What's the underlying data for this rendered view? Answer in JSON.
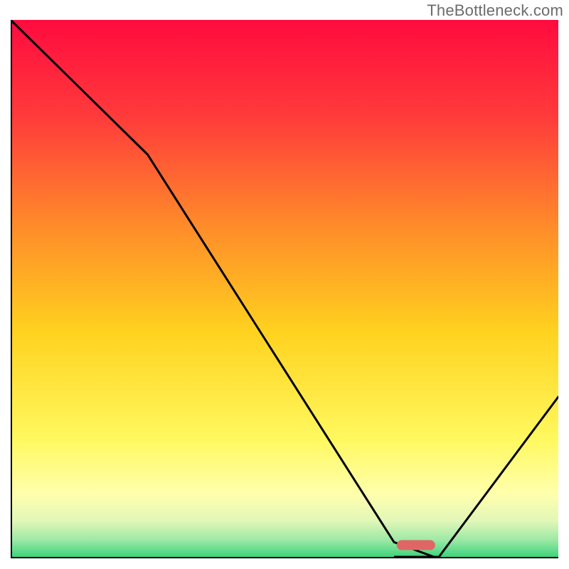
{
  "watermark": "TheBottleneck.com",
  "chart_data": {
    "type": "line",
    "title": "",
    "xlabel": "",
    "ylabel": "",
    "xlim": [
      0,
      100
    ],
    "ylim": [
      0,
      100
    ],
    "grid": false,
    "legend": false,
    "x": [
      0,
      25,
      70,
      78,
      100
    ],
    "y": [
      100,
      75,
      3,
      0,
      30
    ],
    "notch": {
      "x_range": [
        70,
        78
      ],
      "y": 0
    },
    "marker": {
      "shape": "rounded-bar",
      "x_center": 74,
      "y": 1,
      "color": "#e06666"
    },
    "background_gradient": {
      "stops": [
        {
          "pos": 0.0,
          "color": "#ff0b3e"
        },
        {
          "pos": 0.18,
          "color": "#ff3b3b"
        },
        {
          "pos": 0.38,
          "color": "#ff8a2a"
        },
        {
          "pos": 0.58,
          "color": "#ffd21f"
        },
        {
          "pos": 0.78,
          "color": "#fff960"
        },
        {
          "pos": 0.88,
          "color": "#ffffac"
        },
        {
          "pos": 0.93,
          "color": "#e2f7b8"
        },
        {
          "pos": 0.965,
          "color": "#9fe9a7"
        },
        {
          "pos": 1.0,
          "color": "#36d278"
        }
      ]
    }
  }
}
